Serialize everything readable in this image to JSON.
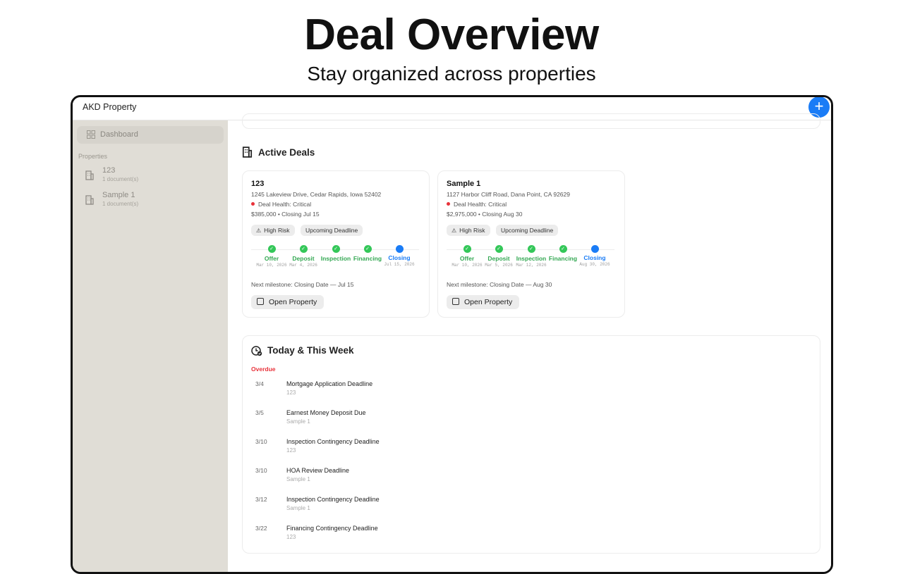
{
  "hero": {
    "title": "Deal Overview",
    "subtitle": "Stay organized across properties"
  },
  "app": {
    "title": "AKD Property",
    "fab_symbol": "+"
  },
  "sidebar": {
    "dashboard_label": "Dashboard",
    "section_label": "Properties",
    "items": [
      {
        "name": "123",
        "sub": "1 document(s)"
      },
      {
        "name": "Sample 1",
        "sub": "1 document(s)"
      }
    ]
  },
  "active_deals": {
    "title": "Active Deals",
    "deals": [
      {
        "name": "123",
        "address": "1245 Lakeview Drive, Cedar Rapids, Iowa 52402",
        "health": "Deal Health: Critical",
        "price_line": "$385,000 • Closing Jul 15",
        "tags": [
          "High Risk",
          "Upcoming Deadline"
        ],
        "milestones": [
          {
            "label": "Offer",
            "date": "Mar 10, 2026"
          },
          {
            "label": "Deposit",
            "date": "Mar 4, 2026"
          },
          {
            "label": "Inspection",
            "date": ""
          },
          {
            "label": "Financing",
            "date": ""
          },
          {
            "label": "Closing",
            "date": "Jul 15, 2026"
          }
        ],
        "next_milestone": "Next milestone: Closing Date — Jul 15",
        "open_label": "Open Property"
      },
      {
        "name": "Sample 1",
        "address": "1127 Harbor Cliff Road, Dana Point, CA 92629",
        "health": "Deal Health: Critical",
        "price_line": "$2,975,000 • Closing Aug 30",
        "tags": [
          "High Risk",
          "Upcoming Deadline"
        ],
        "milestones": [
          {
            "label": "Offer",
            "date": "Mar 10, 2026"
          },
          {
            "label": "Deposit",
            "date": "Mar 5, 2026"
          },
          {
            "label": "Inspection",
            "date": "Mar 12, 2026"
          },
          {
            "label": "Financing",
            "date": ""
          },
          {
            "label": "Closing",
            "date": "Aug 30, 2026"
          }
        ],
        "next_milestone": "Next milestone: Closing Date — Aug 30",
        "open_label": "Open Property"
      }
    ]
  },
  "week": {
    "title": "Today & This Week",
    "overdue_label": "Overdue",
    "events": [
      {
        "date": "3/4",
        "title": "Mortgage Application Deadline",
        "property": "123"
      },
      {
        "date": "3/5",
        "title": "Earnest Money Deposit Due",
        "property": "Sample 1"
      },
      {
        "date": "3/10",
        "title": "Inspection Contingency Deadline",
        "property": "123"
      },
      {
        "date": "3/10",
        "title": "HOA Review Deadline",
        "property": "Sample 1"
      },
      {
        "date": "3/12",
        "title": "Inspection Contingency Deadline",
        "property": "Sample 1"
      },
      {
        "date": "3/22",
        "title": "Financing Contingency Deadline",
        "property": "123"
      }
    ]
  },
  "colors": {
    "accent": "#1a7cf6",
    "success": "#34c759",
    "danger": "#e8323a",
    "sidebar": "#e0ddd6"
  },
  "icons": [
    "grid-icon",
    "building-icon",
    "plus-icon",
    "warning-icon",
    "check-icon",
    "open-icon",
    "calendar-clock-icon"
  ]
}
